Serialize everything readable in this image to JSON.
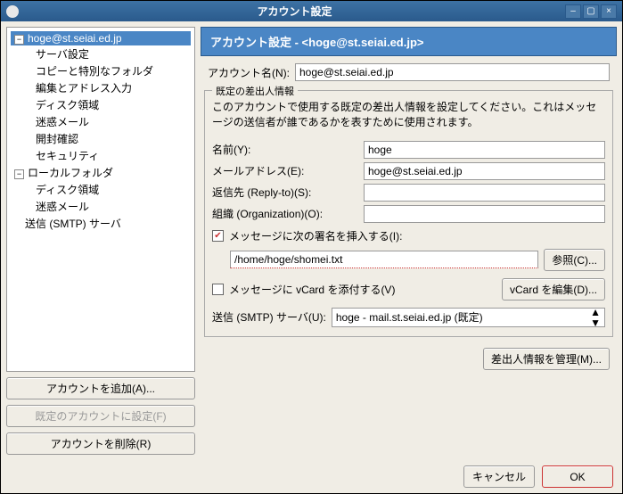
{
  "window": {
    "title": "アカウント設定"
  },
  "tree": {
    "account": "hoge@st.seiai.ed.jp",
    "items": [
      "サーバ設定",
      "コピーと特別なフォルダ",
      "編集とアドレス入力",
      "ディスク領域",
      "迷惑メール",
      "開封確認",
      "セキュリティ"
    ],
    "local": "ローカルフォルダ",
    "local_items": [
      "ディスク領域",
      "迷惑メール"
    ],
    "smtp": "送信 (SMTP) サーバ"
  },
  "left_buttons": {
    "add": "アカウントを追加(A)...",
    "set_default": "既定のアカウントに設定(F)",
    "remove": "アカウントを削除(R)"
  },
  "header": "アカウント設定 - <hoge@st.seiai.ed.jp>",
  "account_name": {
    "label": "アカウント名(N):",
    "value": "hoge@st.seiai.ed.jp"
  },
  "sender": {
    "legend": "既定の差出人情報",
    "description": "このアカウントで使用する既定の差出人情報を設定してください。これはメッセージの送信者が誰であるかを表すために使用されます。",
    "name": {
      "label": "名前(Y):",
      "value": "hoge"
    },
    "email": {
      "label": "メールアドレス(E):",
      "value": "hoge@st.seiai.ed.jp"
    },
    "replyto": {
      "label": "返信先 (Reply-to)(S):",
      "value": ""
    },
    "org": {
      "label": "組織 (Organization)(O):",
      "value": ""
    },
    "sig_check": "メッセージに次の署名を挿入する(I):",
    "sig_path": "/home/hoge/shomei.txt",
    "browse": "参照(C)...",
    "vcard_check": "メッセージに vCard を添付する(V)",
    "vcard_edit": "vCard を編集(D)...",
    "smtp_label": "送信 (SMTP) サーバ(U):",
    "smtp_value": "hoge - mail.st.seiai.ed.jp (既定)"
  },
  "manage_identities": "差出人情報を管理(M)...",
  "dialog": {
    "cancel": "キャンセル",
    "ok": "OK"
  }
}
